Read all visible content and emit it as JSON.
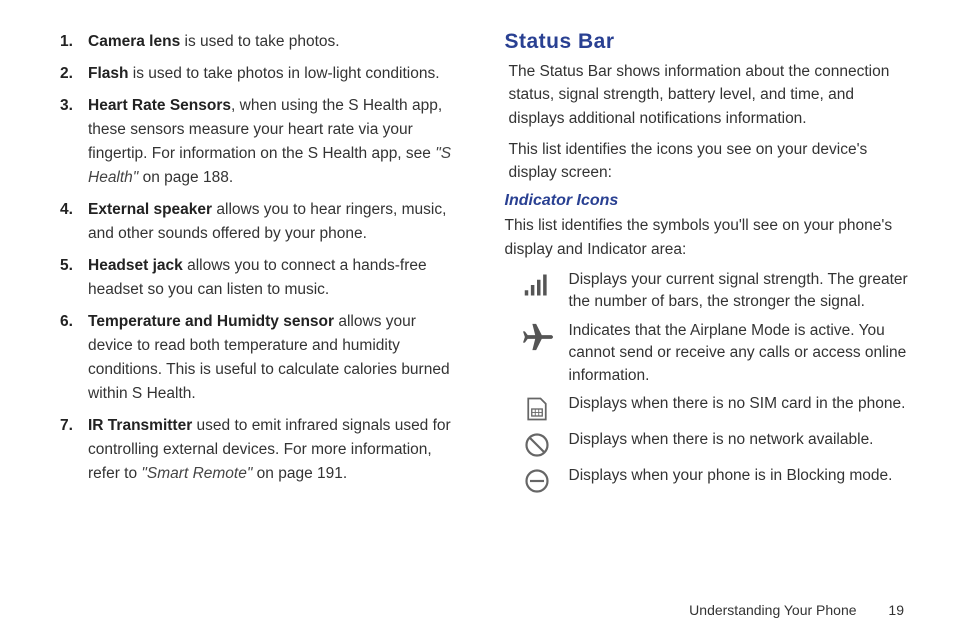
{
  "leftList": [
    {
      "num": "1.",
      "bold": "Camera lens",
      "rest": " is used to take photos."
    },
    {
      "num": "2.",
      "bold": "Flash",
      "rest": " is used to take photos in low-light conditions."
    },
    {
      "num": "3.",
      "bold": "Heart Rate Sensors",
      "rest": ", when using the S Health app, these sensors measure your heart rate via your fingertip. For information on the S Health app, see ",
      "ref": "\"S Health\"",
      "tail": " on page 188."
    },
    {
      "num": "4.",
      "bold": "External speaker",
      "rest": " allows you to hear ringers, music, and other sounds offered by your phone."
    },
    {
      "num": "5.",
      "bold": "Headset jack",
      "rest": " allows you to connect a hands-free headset so you can listen to music."
    },
    {
      "num": "6.",
      "bold": "Temperature and Humidty sensor",
      "rest": " allows your device to read both temperature and humidity conditions. This is useful to calculate calories burned within S Health."
    },
    {
      "num": "7.",
      "bold": "IR Transmitter",
      "rest": " used to emit infrared signals used for controlling external devices. For more information, refer to ",
      "ref": "\"Smart Remote\" ",
      "tail": " on page 191."
    }
  ],
  "statusBar": {
    "heading": "Status Bar",
    "p1": "The Status Bar shows information about the connection status, signal strength, battery level, and time, and displays additional notifications information.",
    "p2": "This list identifies the icons you see on your device's display screen:"
  },
  "indicator": {
    "heading": "Indicator Icons",
    "intro": "This list identifies the symbols you'll see on your phone's display and Indicator area:"
  },
  "icons": [
    {
      "name": "signal-strength-icon",
      "desc": "Displays your current signal strength. The greater the number of bars, the stronger the signal."
    },
    {
      "name": "airplane-mode-icon",
      "desc": "Indicates that the Airplane Mode is active. You cannot send or receive any calls or access online information."
    },
    {
      "name": "no-sim-icon",
      "desc": "Displays when there is no SIM card in the phone."
    },
    {
      "name": "no-network-icon",
      "desc": "Displays when there is no network available."
    },
    {
      "name": "blocking-mode-icon",
      "desc": "Displays when your phone is in Blocking mode."
    }
  ],
  "footer": {
    "section": "Understanding Your Phone",
    "page": "19"
  }
}
